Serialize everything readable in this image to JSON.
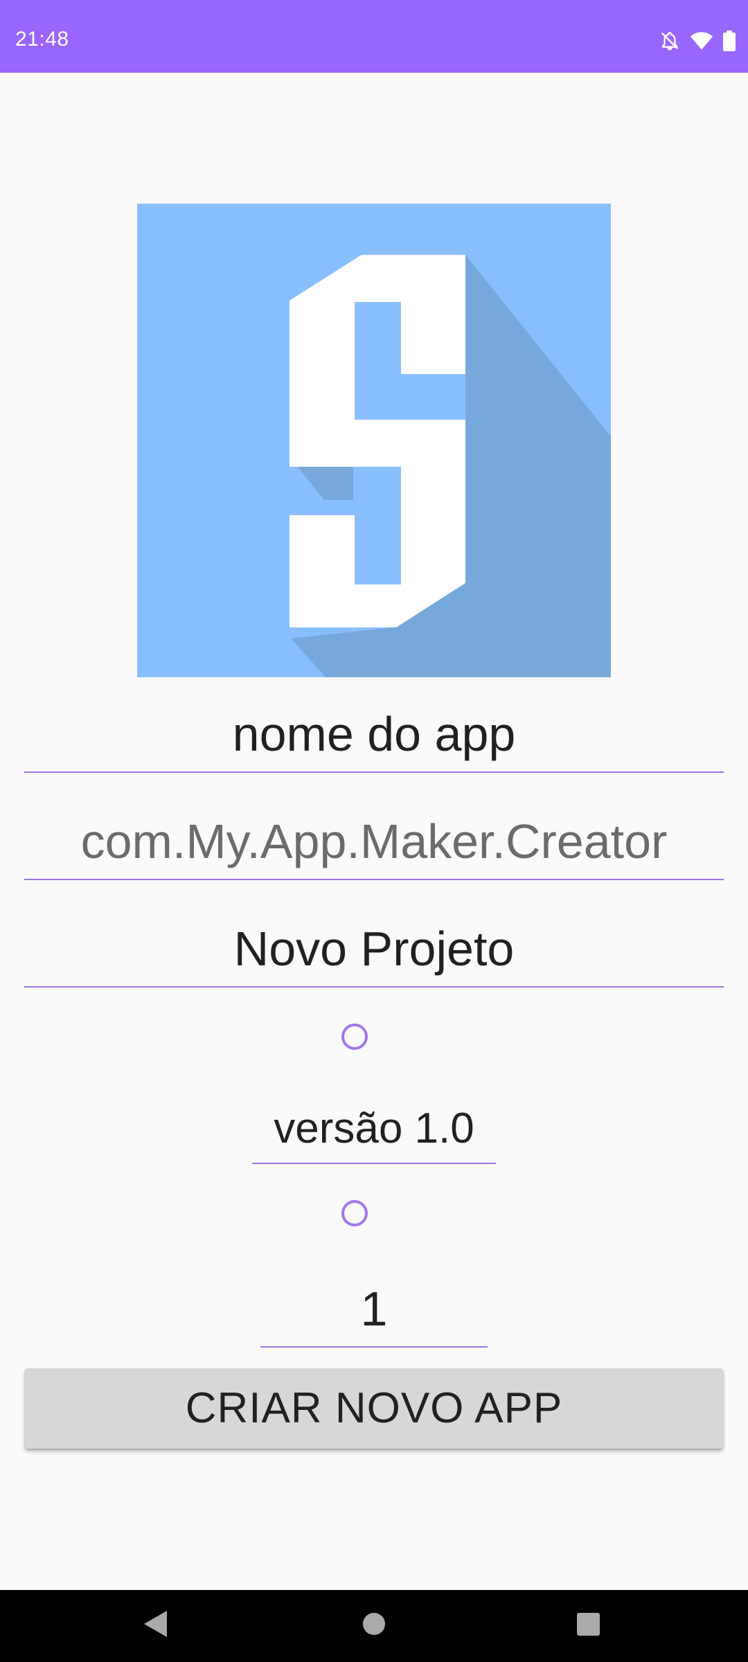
{
  "status_bar": {
    "time": "21:48",
    "icons": [
      "notifications-off-icon",
      "wifi-icon",
      "battery-icon"
    ],
    "background": "#9966ff"
  },
  "logo": {
    "icon": "sketchware-s-logo",
    "background": "#8abfff",
    "shadow": "#77a8dc",
    "letter_color": "#ffffff"
  },
  "form": {
    "app_name": {
      "value": "nome do app"
    },
    "package_name": {
      "value": "com.My.App.Maker.Creator"
    },
    "project_name": {
      "value": "Novo Projeto"
    },
    "version_name": {
      "value": "versão 1.0"
    },
    "version_code": {
      "value": "1"
    },
    "accent_color": "#9f74e6"
  },
  "create_button": {
    "label": "CRIAR NOVO APP",
    "background": "#d6d7d7"
  },
  "nav_bar": {
    "icons": [
      "back-icon",
      "home-icon",
      "recents-icon"
    ]
  }
}
